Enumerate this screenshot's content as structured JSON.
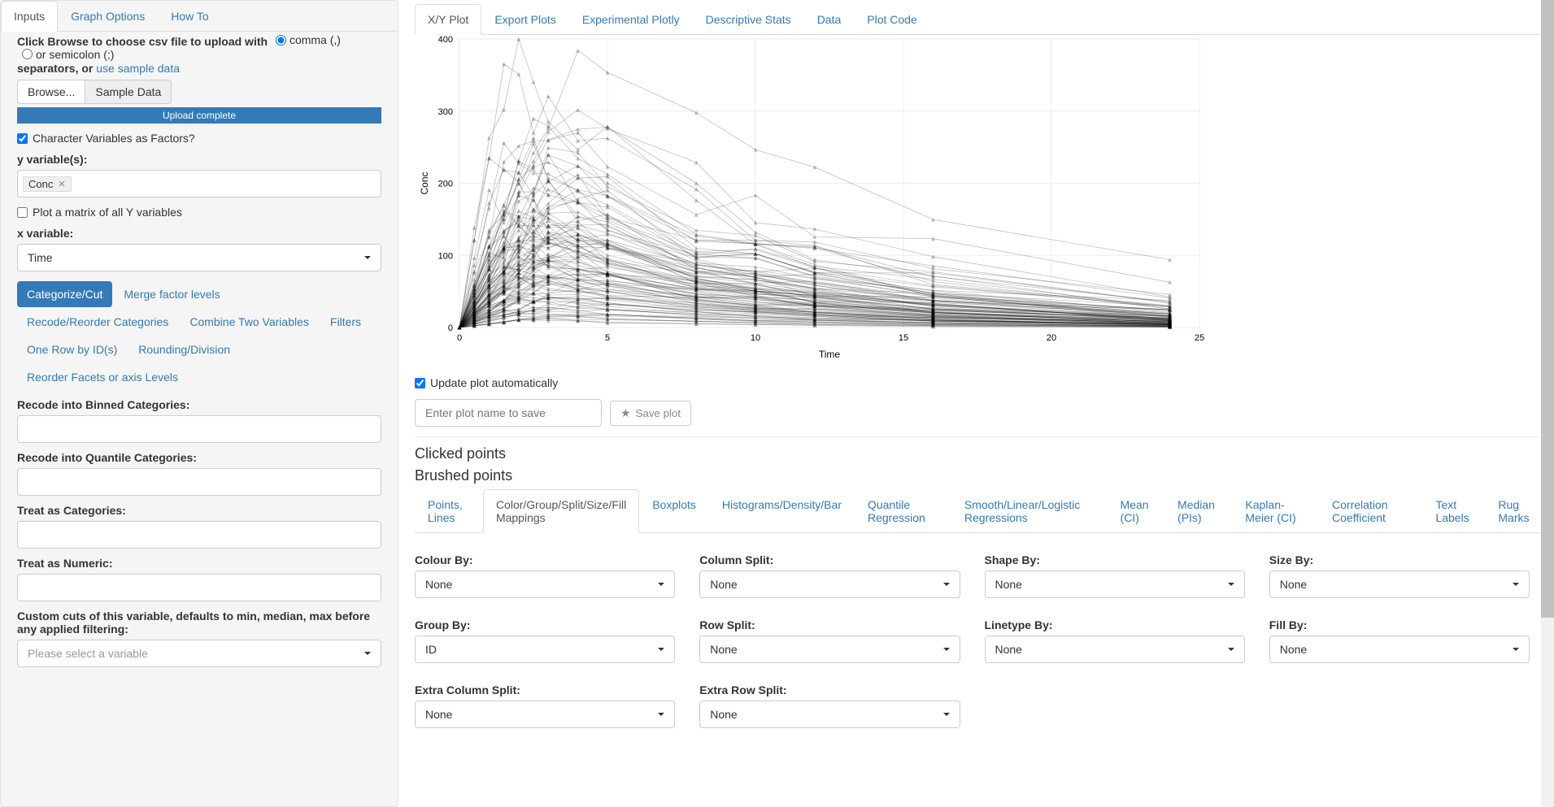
{
  "sidebar_tabs": [
    "Inputs",
    "Graph Options",
    "How To"
  ],
  "upload": {
    "help_prefix": "Click Browse to choose csv file to upload with",
    "radio_comma": "comma (,)",
    "radio_semicolon": "or semicolon (;)",
    "help_suffix": "separators, or",
    "sample_link": "use sample data",
    "browse_label": "Browse...",
    "sample_data_label": "Sample Data",
    "progress_text": "Upload complete"
  },
  "char_factors_label": "Character Variables as Factors?",
  "y_var": {
    "label": "y variable(s):",
    "value": "Conc"
  },
  "plot_matrix_label": "Plot a matrix of all Y variables",
  "x_var": {
    "label": "x variable:",
    "value": "Time"
  },
  "pill_tabs": [
    "Categorize/Cut",
    "Merge factor levels",
    "Recode/Reorder Categories",
    "Combine Two Variables",
    "Filters",
    "One Row by ID(s)",
    "Rounding/Division",
    "Reorder Facets or axis Levels"
  ],
  "recode_binned_label": "Recode into Binned Categories:",
  "recode_quantile_label": "Recode into Quantile Categories:",
  "treat_cat_label": "Treat as Categories:",
  "treat_num_label": "Treat as Numeric:",
  "custom_cuts_label": "Custom cuts of this variable, defaults to min, median, max before any applied filtering:",
  "custom_cuts_placeholder": "Please select a variable",
  "main_tabs": [
    "X/Y Plot",
    "Export Plots",
    "Experimental Plotly",
    "Descriptive Stats",
    "Data",
    "Plot Code"
  ],
  "update_auto_label": "Update plot automatically",
  "plot_name_placeholder": "Enter plot name to save",
  "save_plot_label": "Save plot",
  "clicked_heading": "Clicked points",
  "brushed_heading": "Brushed points",
  "mapping_tabs": [
    "Points, Lines",
    "Color/Group/Split/Size/Fill Mappings",
    "Boxplots",
    "Histograms/Density/Bar",
    "Quantile Regression",
    "Smooth/Linear/Logistic Regressions",
    "Mean (CI)",
    "Median (PIs)",
    "Kaplan-Meier (CI)",
    "Correlation Coefficient",
    "Text Labels",
    "Rug Marks"
  ],
  "mappings": {
    "colour_by": {
      "label": "Colour By:",
      "value": "None"
    },
    "column_split": {
      "label": "Column Split:",
      "value": "None"
    },
    "shape_by": {
      "label": "Shape By:",
      "value": "None"
    },
    "size_by": {
      "label": "Size By:",
      "value": "None"
    },
    "group_by": {
      "label": "Group By:",
      "value": "ID"
    },
    "row_split": {
      "label": "Row Split:",
      "value": "None"
    },
    "linetype_by": {
      "label": "Linetype By:",
      "value": "None"
    },
    "fill_by": {
      "label": "Fill By:",
      "value": "None"
    },
    "extra_col_split": {
      "label": "Extra Column Split:",
      "value": "None"
    },
    "extra_row_split": {
      "label": "Extra Row Split:",
      "value": "None"
    }
  },
  "chart_data": {
    "type": "line",
    "xlabel": "Time",
    "ylabel": "Conc",
    "xlim": [
      0,
      25
    ],
    "ylim": [
      0,
      400
    ],
    "x_ticks": [
      0,
      5,
      10,
      15,
      20,
      25
    ],
    "y_ticks": [
      0,
      100,
      200,
      300,
      400
    ],
    "x_obs": [
      0,
      0.5,
      1,
      1.5,
      2,
      2.5,
      3,
      4,
      5,
      8,
      10,
      12,
      16,
      24
    ],
    "series_peaks": [
      400,
      350,
      345,
      310,
      305,
      280,
      275,
      270,
      265,
      260,
      255,
      250,
      240,
      230,
      220,
      215,
      210,
      205,
      200,
      195,
      190,
      185,
      180,
      175,
      172,
      170,
      168,
      165,
      162,
      160,
      158,
      155,
      152,
      150,
      148,
      146,
      144,
      142,
      140,
      138,
      136,
      134,
      132,
      130,
      128,
      126,
      124,
      122,
      120,
      118,
      116,
      114,
      112,
      110,
      108,
      106,
      104,
      102,
      100,
      98,
      96,
      94,
      92,
      90,
      88,
      86,
      84,
      82,
      80,
      78,
      76,
      74,
      72,
      70,
      68,
      66,
      64,
      62,
      60,
      58,
      56,
      54,
      52,
      50,
      48,
      46,
      44,
      42,
      40,
      38,
      36,
      34,
      32,
      30,
      28,
      26,
      24,
      22,
      20,
      18,
      16,
      14,
      12,
      10
    ],
    "note": "Spaghetti plot of many subjects' concentration-time PK profiles. Each series starts at 0, peaks between t=1 and t=5, then decays toward t=24. series_peaks are representative peak Conc values per subject used to regenerate the visual."
  }
}
